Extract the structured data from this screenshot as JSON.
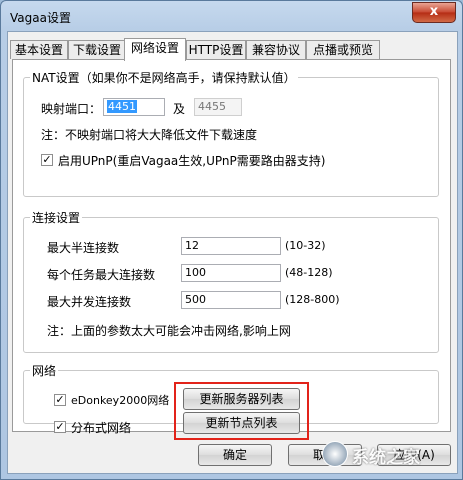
{
  "window": {
    "title": "Vagaa设置",
    "close_glyph": "x"
  },
  "tabs": [
    {
      "label": "基本设置",
      "active": false
    },
    {
      "label": "下载设置",
      "active": false
    },
    {
      "label": "网络设置",
      "active": true
    },
    {
      "label": "HTTP设置",
      "active": false
    },
    {
      "label": "兼容协议",
      "active": false
    },
    {
      "label": "点播或预览",
      "active": false
    }
  ],
  "nat": {
    "legend": "NAT设置（如果你不是网络高手，请保持默认值）",
    "port_label": "映射端口：",
    "port_value": "4451",
    "and_label": "及",
    "port2_value": "4455",
    "note": "注：不映射端口将大大降低文件下载速度",
    "upnp_checked": true,
    "upnp_label": "启用UPnP(重启Vagaa生效,UPnP需要路由器支持)"
  },
  "connections": {
    "legend": "连接设置",
    "rows": [
      {
        "label": "最大半连接数",
        "value": "12",
        "range": "(10-32)"
      },
      {
        "label": "每个任务最大连接数",
        "value": "100",
        "range": "(48-128)"
      },
      {
        "label": "最大并发连接数",
        "value": "500",
        "range": "(128-800)"
      }
    ],
    "note": "注：上面的参数太大可能会冲击网络,影响上网"
  },
  "network": {
    "legend": "网络",
    "edonkey_checked": true,
    "edonkey_label": "eDonkey2000网络",
    "dist_checked": true,
    "dist_label": "分布式网络",
    "update_servers_label": "更新服务器列表",
    "update_nodes_label": "更新节点列表"
  },
  "footer": {
    "ok_label": "确定",
    "cancel_label": "取消",
    "apply_label": "应用(A)"
  },
  "watermark": {
    "text": "系统之家"
  },
  "colors": {
    "highlight": "#e2231a",
    "selection": "#3399ff",
    "close_button": "#c7462f"
  }
}
